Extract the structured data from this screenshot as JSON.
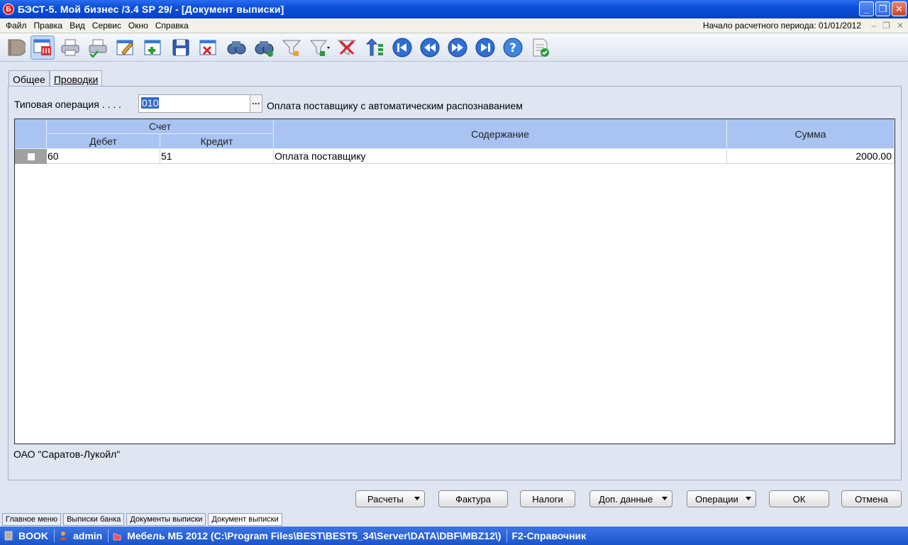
{
  "window": {
    "title": "БЭСТ-5. Мой бизнес /3.4 SP 29/ - [Документ выписки]",
    "app_icon": "Б",
    "controls": [
      "_",
      "❐",
      "✕"
    ]
  },
  "menu": {
    "items": [
      "Файл",
      "Правка",
      "Вид",
      "Сервис",
      "Окно",
      "Справка"
    ],
    "period_label": "Начало расчетного периода: 01/01/2012",
    "mdi_controls": [
      "–",
      "❐",
      "✕"
    ]
  },
  "toolbar": {
    "icons": [
      "book-icon",
      "document-view-icon",
      "print-icon",
      "print-preview-icon",
      "edit-icon",
      "add-record-icon",
      "save-icon",
      "delete-record-icon",
      "find-icon",
      "find-next-icon",
      "filter-icon",
      "filter-dropdown-icon",
      "clear-filter-icon",
      "sort-icon",
      "first-record-icon",
      "previous-record-icon",
      "next-record-icon",
      "last-record-icon",
      "help-icon",
      "document-check-icon"
    ]
  },
  "tabs": [
    {
      "label": "Общее",
      "active": true
    },
    {
      "label": "Проводки",
      "active": false
    }
  ],
  "operation": {
    "label": "Типовая операция . . . .",
    "value": "010",
    "description": "Оплата поставщику с автоматическим распознаванием"
  },
  "grid": {
    "headers": {
      "account": "Счет",
      "debit": "Дебет",
      "credit": "Кредит",
      "content": "Содержание",
      "amount": "Сумма"
    },
    "rows": [
      {
        "debit": "60",
        "credit": "51",
        "content": "Оплата поставщику",
        "amount": "2000.00"
      }
    ]
  },
  "company": "ОАО \"Саратов-Лукойл\"",
  "buttons": {
    "settlements": "Расчеты",
    "invoice": "Фактура",
    "taxes": "Налоги",
    "extra": "Доп. данные",
    "operations": "Операции",
    "ok": "ОК",
    "cancel": "Отмена"
  },
  "switcher": [
    "Главное меню",
    "Выписки банка",
    "Документы выписки",
    "Документ выписки"
  ],
  "status": {
    "db": "BOOK",
    "user": "admin",
    "path": "Мебель МБ 2012 (C:\\Program Files\\BEST\\BEST5_34\\Server\\DATA\\DBF\\MBZ12\\)",
    "hint": "F2-Справочник"
  },
  "colors": {
    "title_bar": "#0a4fd8",
    "grid_header": "#a9c4f3",
    "selection": "#316ac5",
    "status_bar": "#1c55c9"
  }
}
